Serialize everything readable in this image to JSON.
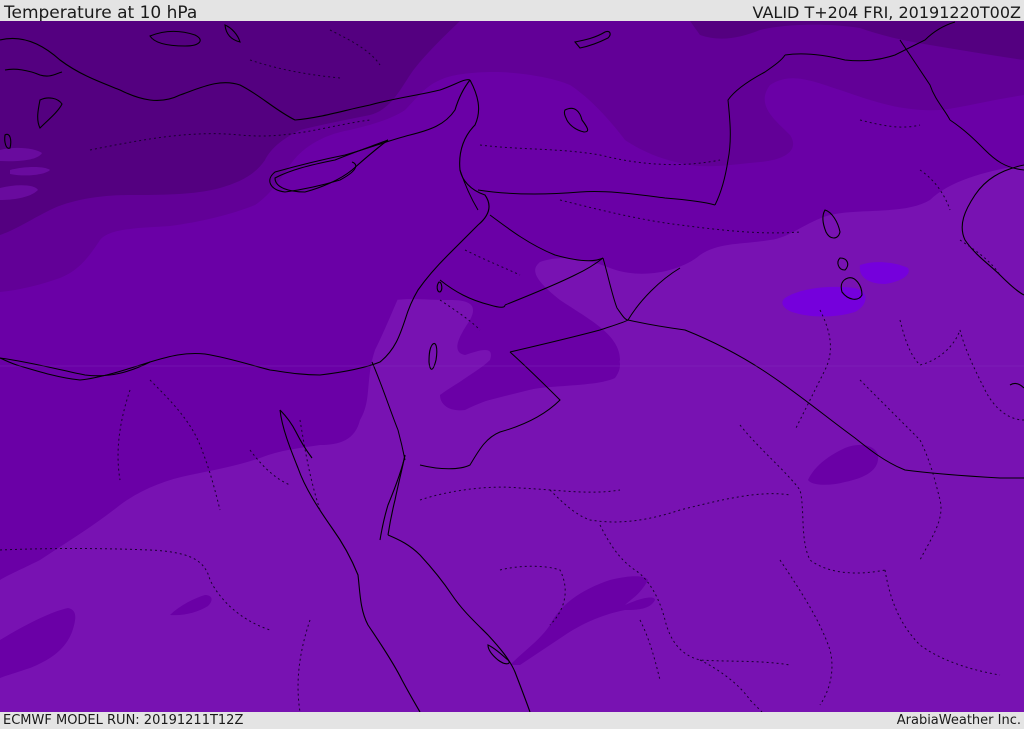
{
  "header": {
    "title": "Temperature at 10 hPa",
    "valid_time": "VALID T+204 FRI, 20191220T00Z"
  },
  "footer": {
    "model_run": "ECMWF MODEL RUN: 20191211T12Z",
    "credit": "ArabiaWeather Inc."
  },
  "map": {
    "region": "Eastern Mediterranean & Middle East",
    "colors": {
      "darkest": "#540080",
      "dark": "#620097",
      "medium": "#6a00a6",
      "base": "#7812b2",
      "light": "#7500dc",
      "coast": "#000000",
      "border": "#1a0030"
    }
  }
}
